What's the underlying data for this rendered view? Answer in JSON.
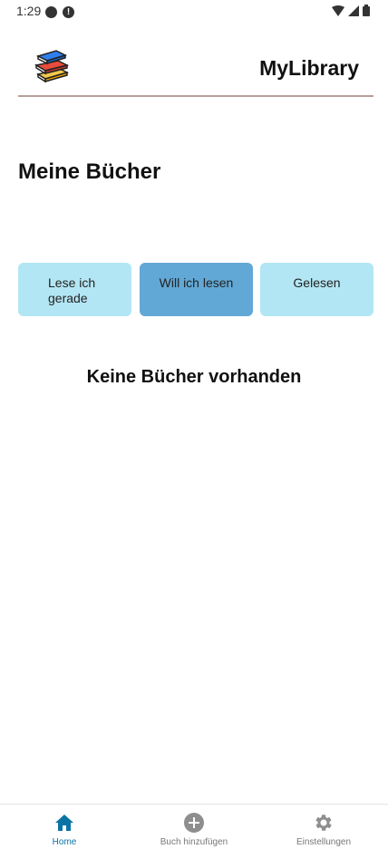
{
  "status": {
    "time": "1:29"
  },
  "header": {
    "app_title": "MyLibrary",
    "logo_icon": "books-stack-icon"
  },
  "main": {
    "title": "Meine Bücher",
    "filters": [
      {
        "label": "Lese ich gerade",
        "active": false
      },
      {
        "label": "Will ich lesen",
        "active": true
      },
      {
        "label": "Gelesen",
        "active": false
      }
    ],
    "empty_message": "Keine Bücher vorhanden"
  },
  "bottom_nav": {
    "items": [
      {
        "label": "Home",
        "icon": "home-icon",
        "active": true
      },
      {
        "label": "Buch hinzufügen",
        "icon": "add-circle-icon",
        "active": false
      },
      {
        "label": "Einstellungen",
        "icon": "gear-icon",
        "active": false
      }
    ]
  },
  "colors": {
    "filter_inactive": "#b3e6f4",
    "filter_active": "#62a8d6",
    "nav_active": "#0a73a4",
    "divider": "#b79f98"
  }
}
